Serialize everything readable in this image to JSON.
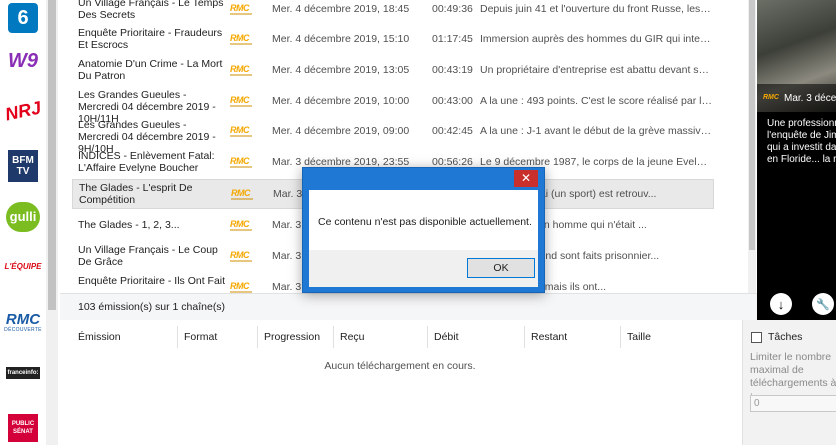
{
  "channels": [
    {
      "name": "M6",
      "label": "6",
      "color": "#0079c1"
    },
    {
      "name": "W9",
      "label": "W9",
      "color": "#8a2fb5"
    },
    {
      "name": "NRJ12",
      "label": "NRJ",
      "color": "#e2001a"
    },
    {
      "name": "BFMTV",
      "label": "BFM TV",
      "color": "#1f3a6a"
    },
    {
      "name": "Gulli",
      "label": "gulli",
      "color": "#7bbd20"
    },
    {
      "name": "L'Equipe",
      "label": "L'ÉQUIPE",
      "color": "#d90a16"
    },
    {
      "name": "RMC Découverte",
      "label": "RMC",
      "sub": "DÉCOUVERTE",
      "color": "#1a5ba6"
    },
    {
      "name": "franceinfo",
      "label": "franceinfo:",
      "color": "#222222"
    },
    {
      "name": "Public Sénat",
      "label": "PUBLIC SÉNAT",
      "color": "#d4003a"
    }
  ],
  "programs": [
    {
      "title": "Un Village Français - Le Temps Des Secrets",
      "channel": "RMC",
      "date": "Mer. 4 décembre 2019, 18:45",
      "duration": "00:49:36",
      "desc": "Depuis juin 41 et l'ouverture du front Russe, les milit..."
    },
    {
      "title": "Enquête Prioritaire - Fraudeurs Et Escrocs",
      "channel": "RMC",
      "date": "Mer. 4 décembre 2019, 15:10",
      "duration": "01:17:45",
      "desc": "Immersion auprès des hommes du GIR qui intervien..."
    },
    {
      "title": "Anatomie D'un Crime - La Mort Du Patron",
      "channel": "RMC",
      "date": "Mer. 4 décembre 2019, 13:05",
      "duration": "00:43:19",
      "desc": "Un propriétaire d'entreprise est abattu devant son bu..."
    },
    {
      "title": "Les Grandes Gueules - Mercredi 04 décembre 2019 - 10H/11H",
      "channel": "RMC",
      "date": "Mer. 4 décembre 2019, 10:00",
      "duration": "00:43:00",
      "desc": "A la une : 493 points. C'est le score réalisé par les élé..."
    },
    {
      "title": "Les Grandes Gueules - Mercredi 04 décembre 2019 - 9H/10H",
      "channel": "RMC",
      "date": "Mer. 4 décembre 2019, 09:00",
      "duration": "00:42:45",
      "desc": "A la une : J-1 avant le début de la grève massive nati..."
    },
    {
      "title": "INDICES - Enlèvement Fatal: L'Affaire Evelyne Boucher",
      "channel": "RMC",
      "date": "Mar. 3 décembre 2019, 23:55",
      "duration": "00:56:26",
      "desc": "Le 9 décembre 1987, le corps de la jeune Evelyne Bo..."
    },
    {
      "title": "The Glades - L'esprit De Compétition",
      "channel": "RMC",
      "date": "Mar. 3",
      "duration": "",
      "desc": "elle de Jai Alai (un sport) est retrouv..."
    },
    {
      "title": "The Glades - 1, 2, 3...",
      "channel": "RMC",
      "date": "Mar. 3",
      "duration": "",
      "desc": "le meurtre d'un homme qui n'était ..."
    },
    {
      "title": "Un Village Français - Le Coup De Grâce",
      "channel": "RMC",
      "date": "Mar. 3",
      "duration": "",
      "desc": "arie et Raymond sont faits prisonnier..."
    },
    {
      "title": "Enquête Prioritaire - Ils Ont Fait",
      "channel": "RMC",
      "date": "Mar. 3",
      "duration": "",
      "desc": "us leur limite, mais ils ont..."
    }
  ],
  "count_text": "103 émission(s) sur 1 chaîne(s)",
  "preview": {
    "channel": "RMC",
    "date": "Mar. 3 déce",
    "desc_lines": [
      "Une professionn",
      "l'enquête de Jim",
      "qui a investit da",
      "en Floride... la ré"
    ]
  },
  "downloads": {
    "columns": [
      "Émission",
      "Format",
      "Progression",
      "Reçu",
      "Débit",
      "Restant",
      "Taille"
    ],
    "empty_text": "Aucun téléchargement en cours."
  },
  "tasks": {
    "label": "Tâches",
    "limit_text": "Limiter le nombre maximal de téléchargements à :",
    "value": "0"
  },
  "dialog": {
    "message": "Ce contenu n'est pas disponible actuellement.",
    "ok_label": "OK",
    "close_label": "✕"
  }
}
